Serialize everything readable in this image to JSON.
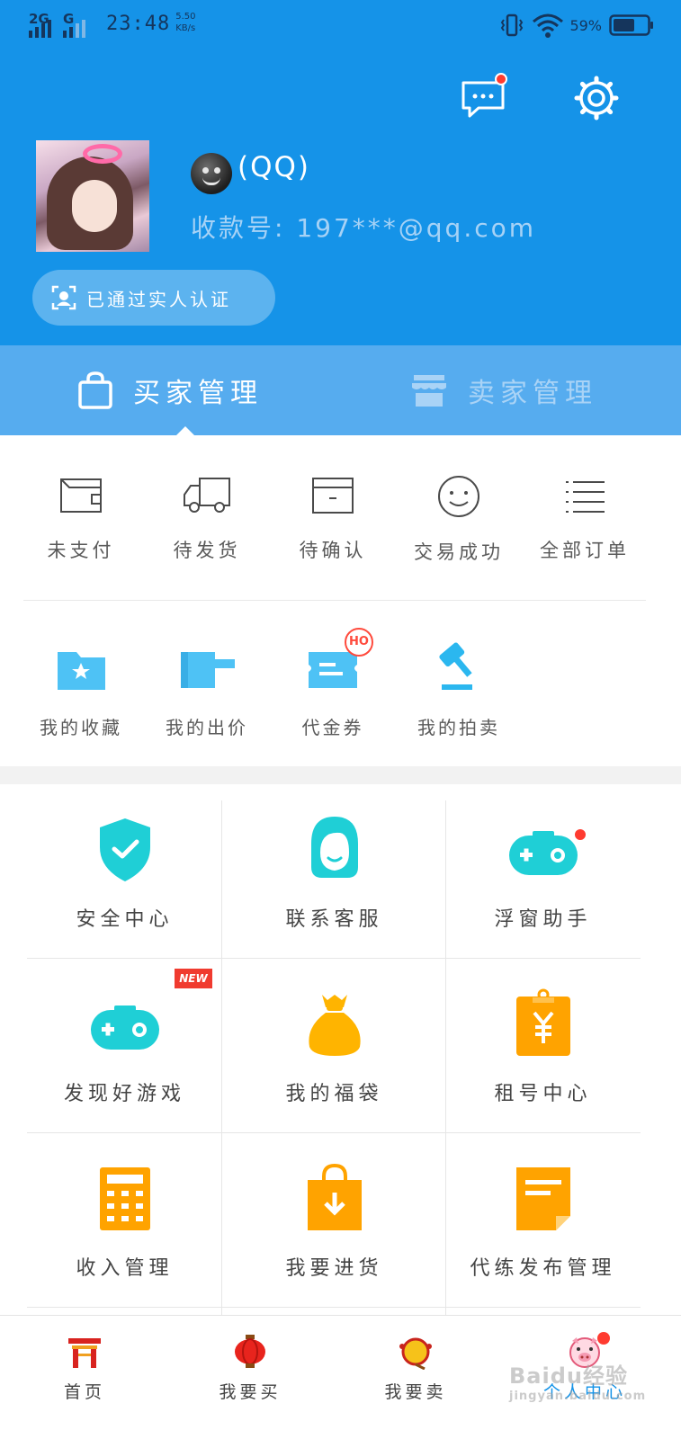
{
  "status_bar": {
    "network_1": "2G",
    "network_2": "G",
    "time": "23:48",
    "speed_value": "5.50",
    "speed_unit": "KB/s",
    "battery": "59%"
  },
  "header": {
    "nickname": "(QQ)",
    "account": "收款号: 197***@qq.com",
    "verify_text": "已通过实人认证"
  },
  "role_tabs": [
    {
      "label": "买家管理",
      "active": true
    },
    {
      "label": "卖家管理",
      "active": false
    }
  ],
  "orders": [
    {
      "label": "未支付",
      "icon": "wallet-icon"
    },
    {
      "label": "待发货",
      "icon": "truck-icon"
    },
    {
      "label": "待确认",
      "icon": "box-icon"
    },
    {
      "label": "交易成功",
      "icon": "smile-icon"
    },
    {
      "label": "全部订单",
      "icon": "list-icon"
    }
  ],
  "assets": [
    {
      "label": "我的收藏",
      "icon": "star-folder-icon"
    },
    {
      "label": "我的出价",
      "icon": "bid-icon"
    },
    {
      "label": "代金券",
      "icon": "coupon-icon",
      "badge": "HO"
    },
    {
      "label": "我的拍卖",
      "icon": "gavel-icon"
    }
  ],
  "services": [
    {
      "label": "安全中心",
      "icon": "shield-icon",
      "color": "#1fcfd6"
    },
    {
      "label": "联系客服",
      "icon": "customer-service-icon",
      "color": "#1fcfd6"
    },
    {
      "label": "浮窗助手",
      "icon": "gamepad-icon",
      "color": "#1fcfd6"
    },
    {
      "label": "发现好游戏",
      "icon": "gamepad-icon",
      "color": "#1fcfd6",
      "badge": "NEW"
    },
    {
      "label": "我的福袋",
      "icon": "lucky-bag-icon",
      "color": "#ffb400"
    },
    {
      "label": "租号中心",
      "icon": "yuan-clipboard-icon",
      "color": "#ffa300"
    },
    {
      "label": "收入管理",
      "icon": "calculator-icon",
      "color": "#ffa300"
    },
    {
      "label": "我要进货",
      "icon": "shopping-bag-icon",
      "color": "#ffa300"
    },
    {
      "label": "代练发布管理",
      "icon": "note-icon",
      "color": "#ffa300"
    }
  ],
  "bottom_nav": [
    {
      "label": "首页",
      "icon": "home-gate-icon"
    },
    {
      "label": "我要买",
      "icon": "lantern-icon"
    },
    {
      "label": "我要卖",
      "icon": "drum-icon"
    },
    {
      "label": "个人中心",
      "icon": "pig-avatar-icon",
      "active": true
    }
  ],
  "watermark": {
    "text": "Baidu经验",
    "sub": "jingyan.baidu.com"
  },
  "colors": {
    "primary": "#1593e8",
    "tab_band": "#56acef",
    "teal": "#1fcfd6",
    "orange": "#ffa300",
    "red": "#f03b2f"
  }
}
